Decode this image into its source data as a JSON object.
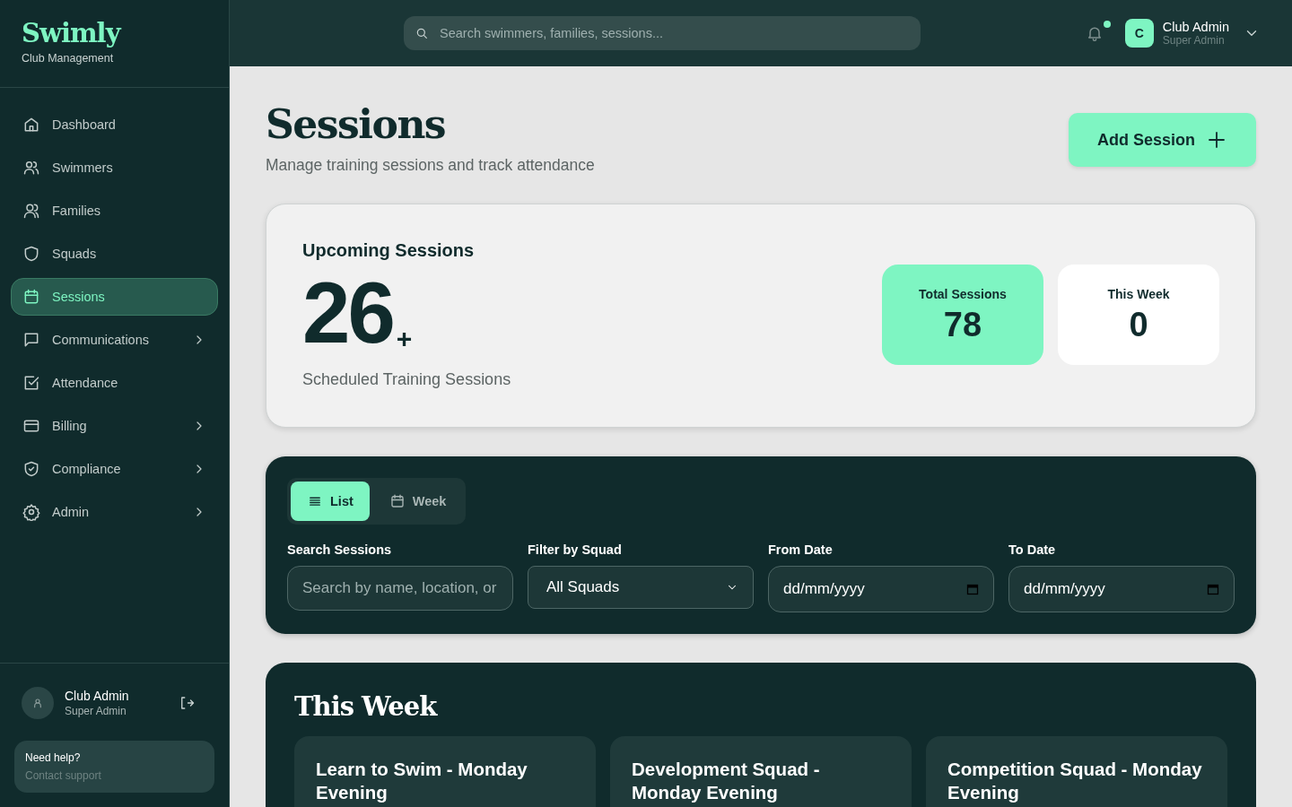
{
  "brand": {
    "name": "Swimly",
    "tagline": "Club Management"
  },
  "sidebar": {
    "items": [
      {
        "label": "Dashboard",
        "selected": false,
        "has_submenu": false
      },
      {
        "label": "Swimmers",
        "selected": false,
        "has_submenu": false
      },
      {
        "label": "Families",
        "selected": false,
        "has_submenu": false
      },
      {
        "label": "Squads",
        "selected": false,
        "has_submenu": false
      },
      {
        "label": "Sessions",
        "selected": true,
        "has_submenu": false
      },
      {
        "label": "Communications",
        "selected": false,
        "has_submenu": true
      },
      {
        "label": "Attendance",
        "selected": false,
        "has_submenu": false
      },
      {
        "label": "Billing",
        "selected": false,
        "has_submenu": true
      },
      {
        "label": "Compliance",
        "selected": false,
        "has_submenu": true
      },
      {
        "label": "Admin",
        "selected": false,
        "has_submenu": true
      }
    ],
    "user": {
      "name": "Club Admin",
      "role": "Super Admin"
    },
    "help": {
      "title": "Need help?",
      "link": "Contact support"
    }
  },
  "topbar": {
    "search": {
      "placeholder": "Search swimmers, families, sessions..."
    },
    "notifications": {
      "unread": true
    },
    "user": {
      "initial": "C",
      "name": "Club Admin",
      "role": "Super Admin"
    }
  },
  "page": {
    "title": "Sessions",
    "subtitle": "Manage training sessions and track attendance",
    "add_button": "Add Session"
  },
  "summary": {
    "heading": "Upcoming Sessions",
    "count": "26",
    "count_suffix": "+",
    "caption": "Scheduled Training Sessions",
    "stats": [
      {
        "label": "Total Sessions",
        "value": "78",
        "highlighted": true
      },
      {
        "label": "This Week",
        "value": "0",
        "highlighted": false
      }
    ]
  },
  "view_toggle": [
    {
      "label": "List",
      "selected": true
    },
    {
      "label": "Week",
      "selected": false
    }
  ],
  "filters": [
    {
      "kind": "text",
      "label": "Search Sessions",
      "placeholder": "Search by name, location, or"
    },
    {
      "kind": "select",
      "label": "Filter by Squad",
      "value": "All Squads"
    },
    {
      "kind": "date",
      "label": "From Date",
      "placeholder": "dd/mm/yyyy"
    },
    {
      "kind": "date",
      "label": "To Date",
      "placeholder": "dd/mm/yyyy"
    }
  ],
  "this_week": {
    "title": "This Week",
    "sessions": [
      {
        "title": "Learn to Swim - Monday Evening"
      },
      {
        "title": "Development Squad - Monday Evening"
      },
      {
        "title": "Competition Squad - Monday Evening"
      }
    ]
  }
}
